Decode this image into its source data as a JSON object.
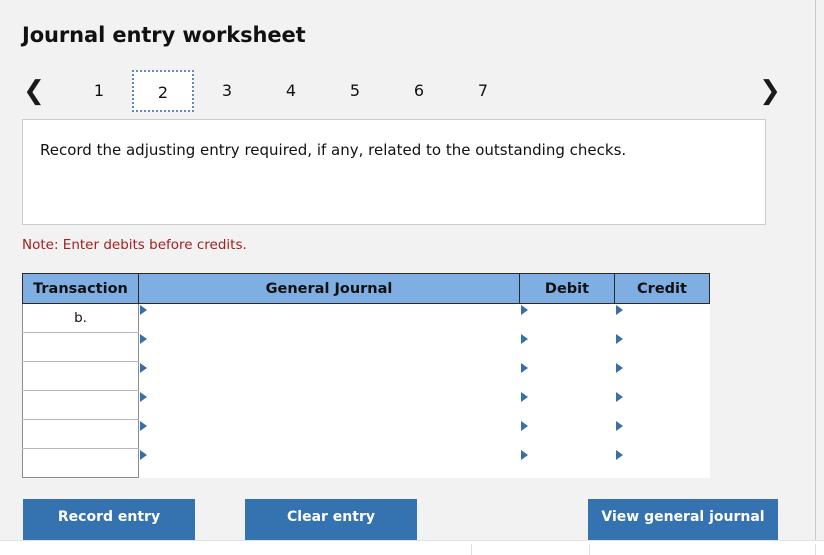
{
  "header": {
    "title": "Journal entry worksheet"
  },
  "pager": {
    "prev_icon": "chevron-left-icon",
    "next_icon": "chevron-right-icon",
    "pages": [
      {
        "label": "1",
        "active": false
      },
      {
        "label": "2",
        "active": true
      },
      {
        "label": "3",
        "active": false
      },
      {
        "label": "4",
        "active": false
      },
      {
        "label": "5",
        "active": false
      },
      {
        "label": "6",
        "active": false
      },
      {
        "label": "7",
        "active": false
      }
    ]
  },
  "instruction": {
    "text": "Record the adjusting entry required, if any, related to the outstanding checks."
  },
  "note": {
    "text": "Note: Enter debits before credits."
  },
  "journal_table": {
    "columns": [
      "Transaction",
      "General Journal",
      "Debit",
      "Credit"
    ],
    "rows": [
      {
        "transaction": "b.",
        "general_journal": "",
        "debit": "",
        "credit": ""
      },
      {
        "transaction": "",
        "general_journal": "",
        "debit": "",
        "credit": ""
      },
      {
        "transaction": "",
        "general_journal": "",
        "debit": "",
        "credit": ""
      },
      {
        "transaction": "",
        "general_journal": "",
        "debit": "",
        "credit": ""
      },
      {
        "transaction": "",
        "general_journal": "",
        "debit": "",
        "credit": ""
      },
      {
        "transaction": "",
        "general_journal": "",
        "debit": "",
        "credit": ""
      }
    ]
  },
  "buttons": {
    "record": "Record entry",
    "clear": "Clear entry",
    "view": "View general journal"
  },
  "colors": {
    "header_blue": "#7eaee2",
    "button_blue": "#3572b0",
    "note_red": "#a32020",
    "page_background": "#f2f2f2",
    "active_page_border": "#5f88bf"
  }
}
